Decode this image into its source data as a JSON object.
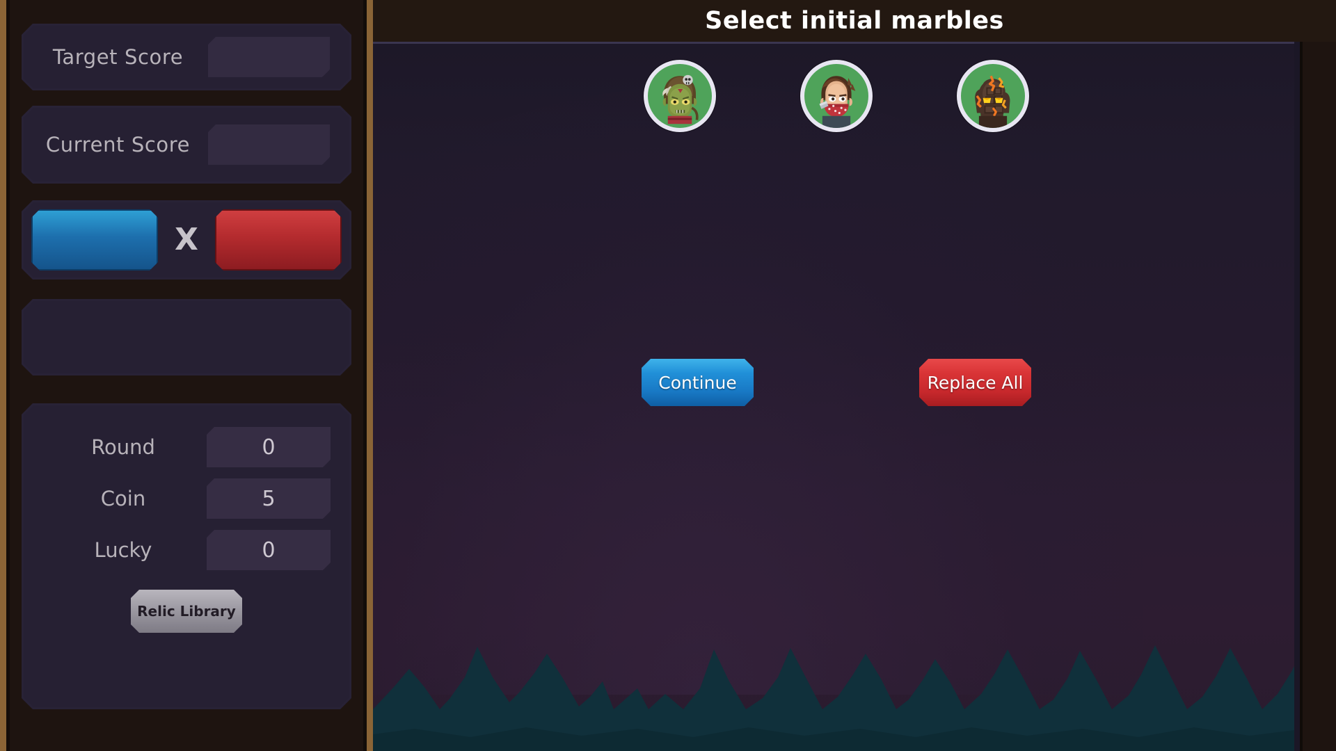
{
  "sidebar": {
    "target_score": {
      "label": "Target Score",
      "value": ""
    },
    "current_score": {
      "label": "Current Score",
      "value": ""
    },
    "multiplier": {
      "operator": "X",
      "left_value": "",
      "right_value": ""
    },
    "relic_slots": {
      "value": ""
    },
    "stats": [
      {
        "label": "Round",
        "value": "0"
      },
      {
        "label": "Coin",
        "value": "5"
      },
      {
        "label": "Lucky",
        "value": "0"
      }
    ],
    "relic_library_button": "Relic Library"
  },
  "main": {
    "title": "Select initial marbles",
    "marbles": [
      {
        "name": "orc-skull-helmet-marble",
        "ring_color": "#e8e6f2",
        "disc_color": "#4fa35a"
      },
      {
        "name": "bandit-red-bandana-marble",
        "ring_color": "#e8e6f2",
        "disc_color": "#4fa35a"
      },
      {
        "name": "magma-rock-golem-marble",
        "ring_color": "#e8e6f2",
        "disc_color": "#4fa35a"
      }
    ],
    "continue_button": "Continue",
    "replace_all_button": "Replace All"
  },
  "colors": {
    "panel_bg": "#262033",
    "readout_bg": "#332b41",
    "blue_chip": "#1d6fad",
    "red_chip": "#b42b2e",
    "frame_brown": "#8a6436",
    "stage_top": "#1d1828",
    "stage_bottom": "#2a1b2e",
    "forest": "#12303a",
    "title_text": "#ffffff"
  }
}
